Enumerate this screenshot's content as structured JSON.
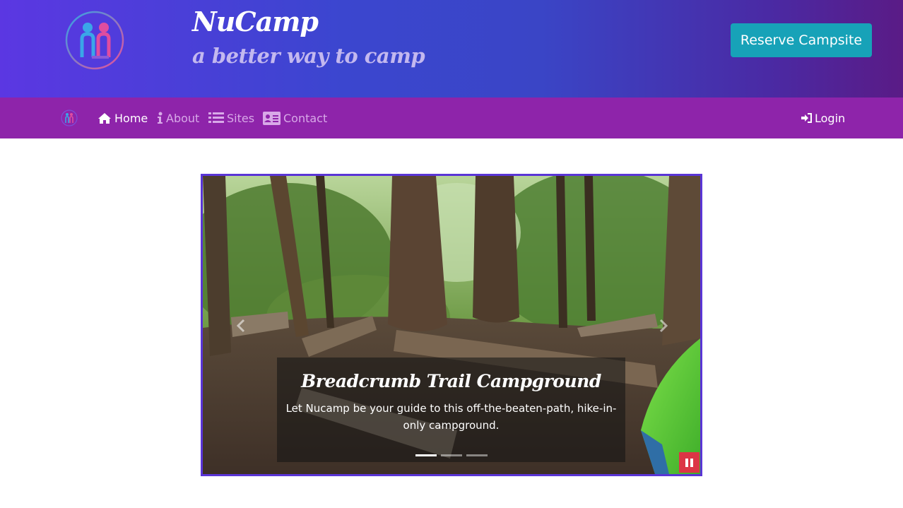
{
  "header": {
    "title": "NuCamp",
    "tagline": "a better way to camp",
    "reserve_button": "Reserve Campsite",
    "logo_icon": "nucamp-logo-icon"
  },
  "nav": {
    "items": [
      {
        "label": "Home",
        "icon": "home-icon",
        "active": true
      },
      {
        "label": "About",
        "icon": "info-icon",
        "active": false
      },
      {
        "label": "Sites",
        "icon": "list-icon",
        "active": false
      },
      {
        "label": "Contact",
        "icon": "address-card-icon",
        "active": false
      }
    ],
    "login": {
      "label": "Login",
      "icon": "sign-in-icon"
    }
  },
  "carousel": {
    "caption_title": "Breadcrumb Trail Campground",
    "caption_text": "Let Nucamp be your guide to this off-the-beaten-path, hike-in-only campground.",
    "slide_count": 3,
    "active_slide": 1,
    "controls": [
      "previous-arrow-icon",
      "next-arrow-icon",
      "pause-icon"
    ]
  },
  "colors": {
    "header_gradient_start": "#5b37e2",
    "header_gradient_end": "#5a1b86",
    "navbar": "#8e24aa",
    "reserve_button": "#17a2b8",
    "carousel_border": "#5a35d6",
    "pause_button": "#dc3545"
  }
}
